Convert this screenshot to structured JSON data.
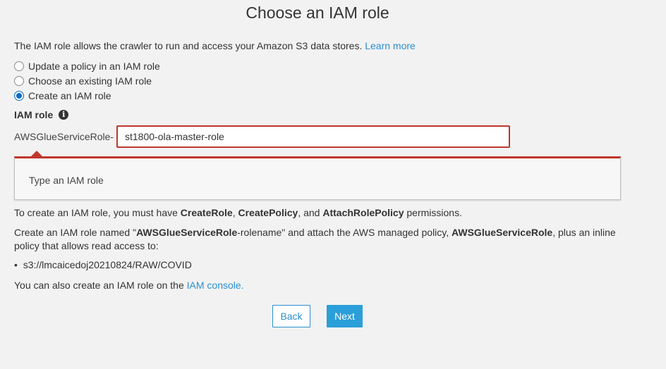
{
  "page": {
    "title": "Choose an IAM role",
    "intro_text": "The IAM role allows the crawler to run and access your Amazon S3 data stores.",
    "learn_more": "Learn more"
  },
  "options": [
    {
      "label": "Update a policy in an IAM role",
      "selected": false
    },
    {
      "label": "Choose an existing IAM role",
      "selected": false
    },
    {
      "label": "Create an IAM role",
      "selected": true
    }
  ],
  "iam_role": {
    "label": "IAM role",
    "info_icon": "info-icon",
    "prefix": "AWSGlueServiceRole-",
    "value": "st1800-ola-master-role",
    "error_message": "Type an IAM role"
  },
  "permissions": {
    "pre": "To create an IAM role, you must have",
    "perm1": "CreateRole",
    "sep1": ",",
    "perm2": "CreatePolicy",
    "sep2": ", and",
    "perm3": "AttachRolePolicy",
    "post": "permissions."
  },
  "create_info": {
    "pre": "Create an IAM role named \"",
    "role_bold": "AWSGlueServiceRole",
    "mid": "-rolename\" and attach the AWS managed policy,",
    "policy_bold": "AWSGlueServiceRole",
    "post": ", plus an inline policy that allows read access to:"
  },
  "s3_paths": [
    "s3://lmcaicedoj20210824/RAW/COVID"
  ],
  "console": {
    "pre": "You can also create an IAM role on the",
    "link": "IAM console."
  },
  "buttons": {
    "back": "Back",
    "next": "Next"
  },
  "colors": {
    "accent": "#2b8fd0",
    "primary_button": "#2b9fd9",
    "error": "#c0362c",
    "background": "#f2f2f2"
  }
}
